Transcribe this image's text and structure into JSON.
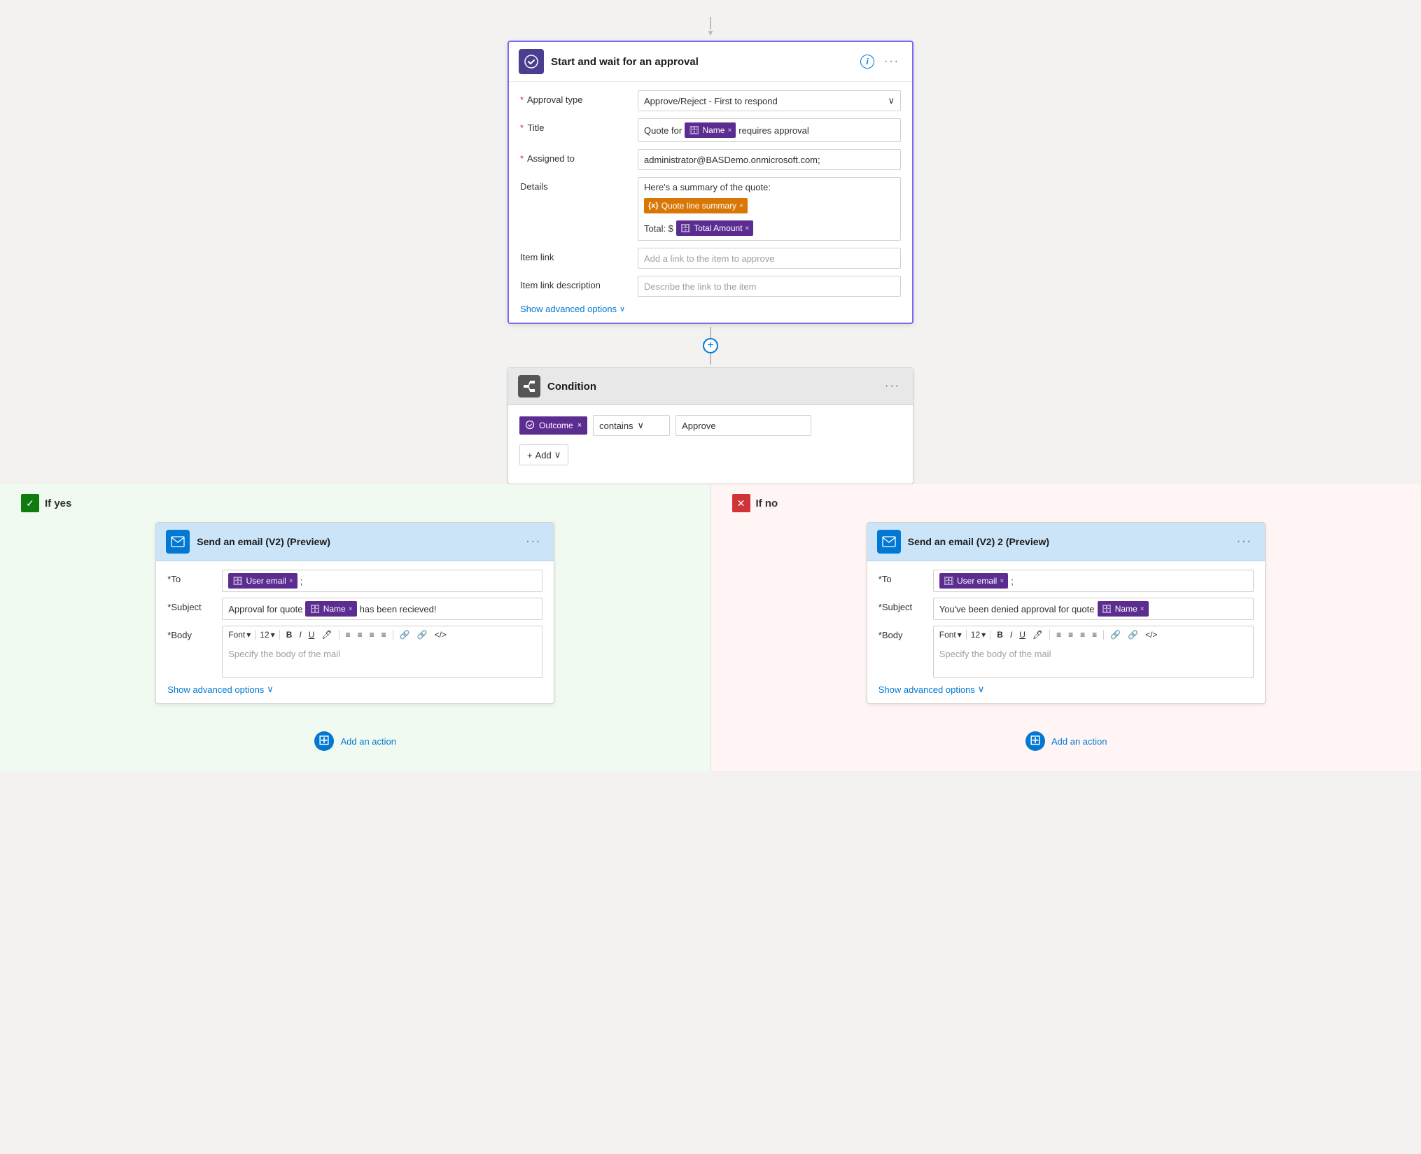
{
  "approval_card": {
    "title": "Start and wait for an approval",
    "approval_type_label": "Approval type",
    "approval_type_value": "Approve/Reject - First to respond",
    "title_label": "Title",
    "title_prefix": "Quote for",
    "title_token": "Name",
    "title_suffix": "requires approval",
    "assigned_to_label": "Assigned to",
    "assigned_to_value": "administrator@BASDemo.onmicrosoft.com;",
    "details_label": "Details",
    "details_line1": "Here's a summary of the quote:",
    "details_token1": "Quote line summary",
    "details_line2_prefix": "Total: $",
    "details_token2": "Total Amount",
    "item_link_label": "Item link",
    "item_link_placeholder": "Add a link to the item to approve",
    "item_link_desc_label": "Item link description",
    "item_link_desc_placeholder": "Describe the link to the item",
    "show_advanced": "Show advanced options"
  },
  "condition_card": {
    "title": "Condition",
    "token_label": "Outcome",
    "operator": "contains",
    "value": "Approve",
    "add_label": "Add"
  },
  "branch_yes": {
    "label": "If yes"
  },
  "branch_no": {
    "label": "If no"
  },
  "email_yes": {
    "title": "Send an email (V2) (Preview)",
    "to_label": "To",
    "to_token": "User email",
    "to_suffix": ";",
    "subject_label": "Subject",
    "subject_prefix": "Approval for quote",
    "subject_token": "Name",
    "subject_suffix": "has been recieved!",
    "body_label": "Body",
    "font_label": "Font",
    "font_size": "12",
    "body_placeholder": "Specify the body of the mail",
    "show_advanced": "Show advanced options",
    "toolbar_items": [
      "B",
      "I",
      "U",
      "🖊",
      "≡",
      "≡",
      "≡",
      "≡",
      "🔗",
      "🔗",
      "</>"
    ]
  },
  "email_no": {
    "title": "Send an email (V2) 2 (Preview)",
    "to_label": "To",
    "to_token": "User email",
    "to_suffix": ";",
    "subject_label": "Subject",
    "subject_prefix": "You've been denied approval for quote",
    "subject_token": "Name",
    "body_label": "Body",
    "font_label": "Font",
    "font_size": "12",
    "body_placeholder": "Specify the body of the mail",
    "show_advanced": "Show advanced options",
    "toolbar_items": [
      "B",
      "I",
      "U",
      "🖊",
      "≡",
      "≡",
      "≡",
      "≡",
      "🔗",
      "🔗",
      "</>"
    ]
  },
  "add_action": {
    "label": "Add an action"
  },
  "icons": {
    "info": "i",
    "dots": "···",
    "dropdown_arrow": "∨",
    "check": "✓",
    "x": "✕",
    "plus": "+",
    "arrow_down": "▼"
  }
}
